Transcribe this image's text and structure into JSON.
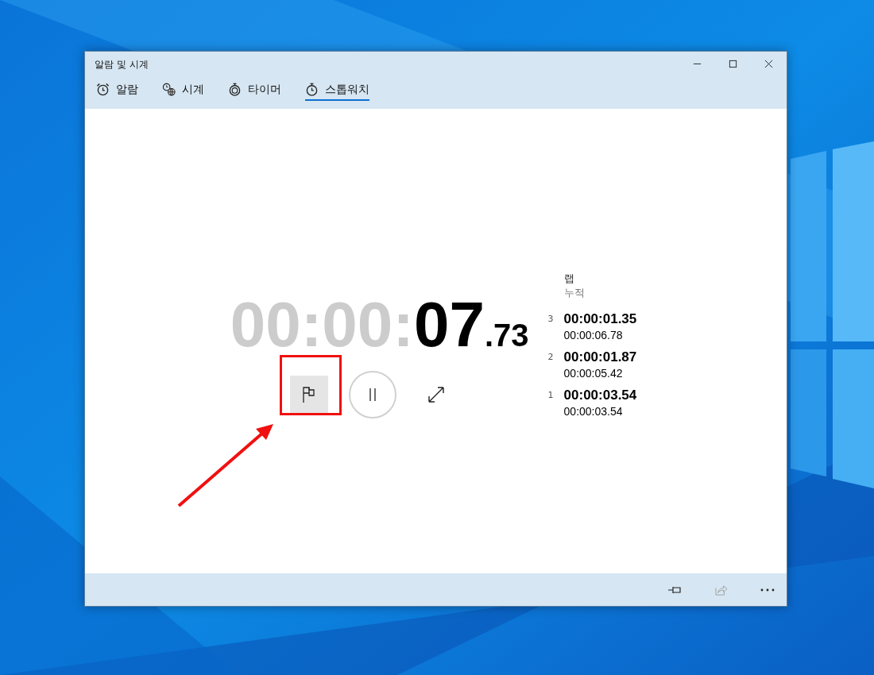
{
  "window": {
    "title": "알람 및 시계"
  },
  "tabs": [
    {
      "label": "알람",
      "kind": "alarm",
      "selected": false
    },
    {
      "label": "시계",
      "kind": "clock",
      "selected": false
    },
    {
      "label": "타이머",
      "kind": "timer",
      "selected": false
    },
    {
      "label": "스톱워치",
      "kind": "stopwatch",
      "selected": true
    }
  ],
  "stopwatch": {
    "elapsed_dim": "00:00:",
    "elapsed_seconds": "07",
    "elapsed_fraction": ".73"
  },
  "laps": {
    "lap_header": "랩",
    "total_header": "누적",
    "rows": [
      {
        "number": "3",
        "lap": "00:00:01.35",
        "total": "00:00:06.78"
      },
      {
        "number": "2",
        "lap": "00:00:01.87",
        "total": "00:00:05.42"
      },
      {
        "number": "1",
        "lap": "00:00:03.54",
        "total": "00:00:03.54"
      }
    ]
  }
}
